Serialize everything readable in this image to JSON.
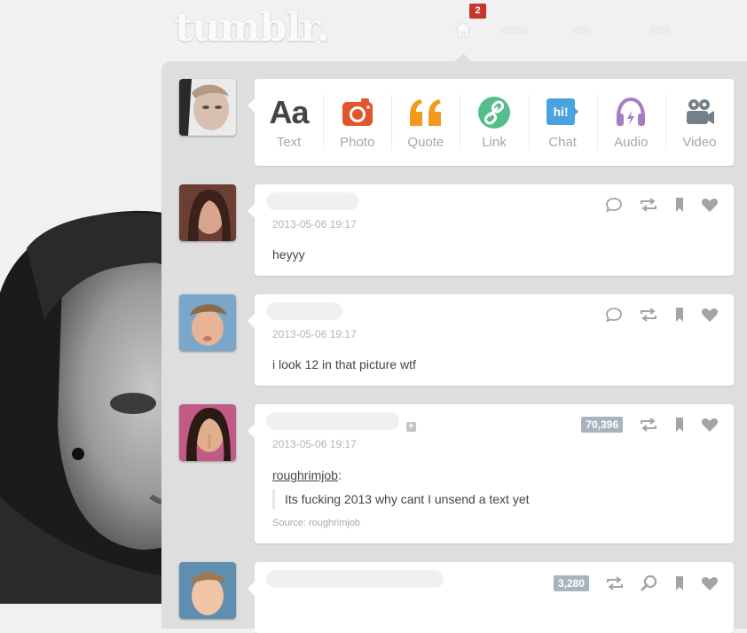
{
  "header": {
    "logo": "tumblr.",
    "notification_count": "2"
  },
  "composer": {
    "types": [
      {
        "label": "Text",
        "icon": "text-aa-icon",
        "glyph": "Aa",
        "color": "#444444"
      },
      {
        "label": "Photo",
        "icon": "camera-icon",
        "color": "#e0562e"
      },
      {
        "label": "Quote",
        "icon": "quote-icon",
        "color": "#f29a1d"
      },
      {
        "label": "Link",
        "icon": "link-icon",
        "color": "#56bc8a"
      },
      {
        "label": "Chat",
        "icon": "chat-icon",
        "glyph": "hi!",
        "color": "#4aa3df"
      },
      {
        "label": "Audio",
        "icon": "headphones-icon",
        "color": "#a77dc2"
      },
      {
        "label": "Video",
        "icon": "video-camera-icon",
        "color": "#748089"
      }
    ]
  },
  "posts": [
    {
      "timestamp": "2013-05-06 19:17",
      "body": "heyyy"
    },
    {
      "timestamp": "2013-05-06 19:17",
      "body": "i look 12 in that picture wtf"
    },
    {
      "timestamp": "2013-05-06 19:17",
      "note_count": "70,396",
      "reblog_from": "roughrimjob",
      "reblog_suffix": ":",
      "quote": "Its fucking 2013 why cant I unsend a text yet",
      "source": "Source: roughrimjob"
    },
    {
      "note_count": "3,280"
    }
  ],
  "colors": {
    "dashboard_bg": "#dedede",
    "badge": "#c7362c",
    "note_count_bg": "#a9b3bd"
  }
}
